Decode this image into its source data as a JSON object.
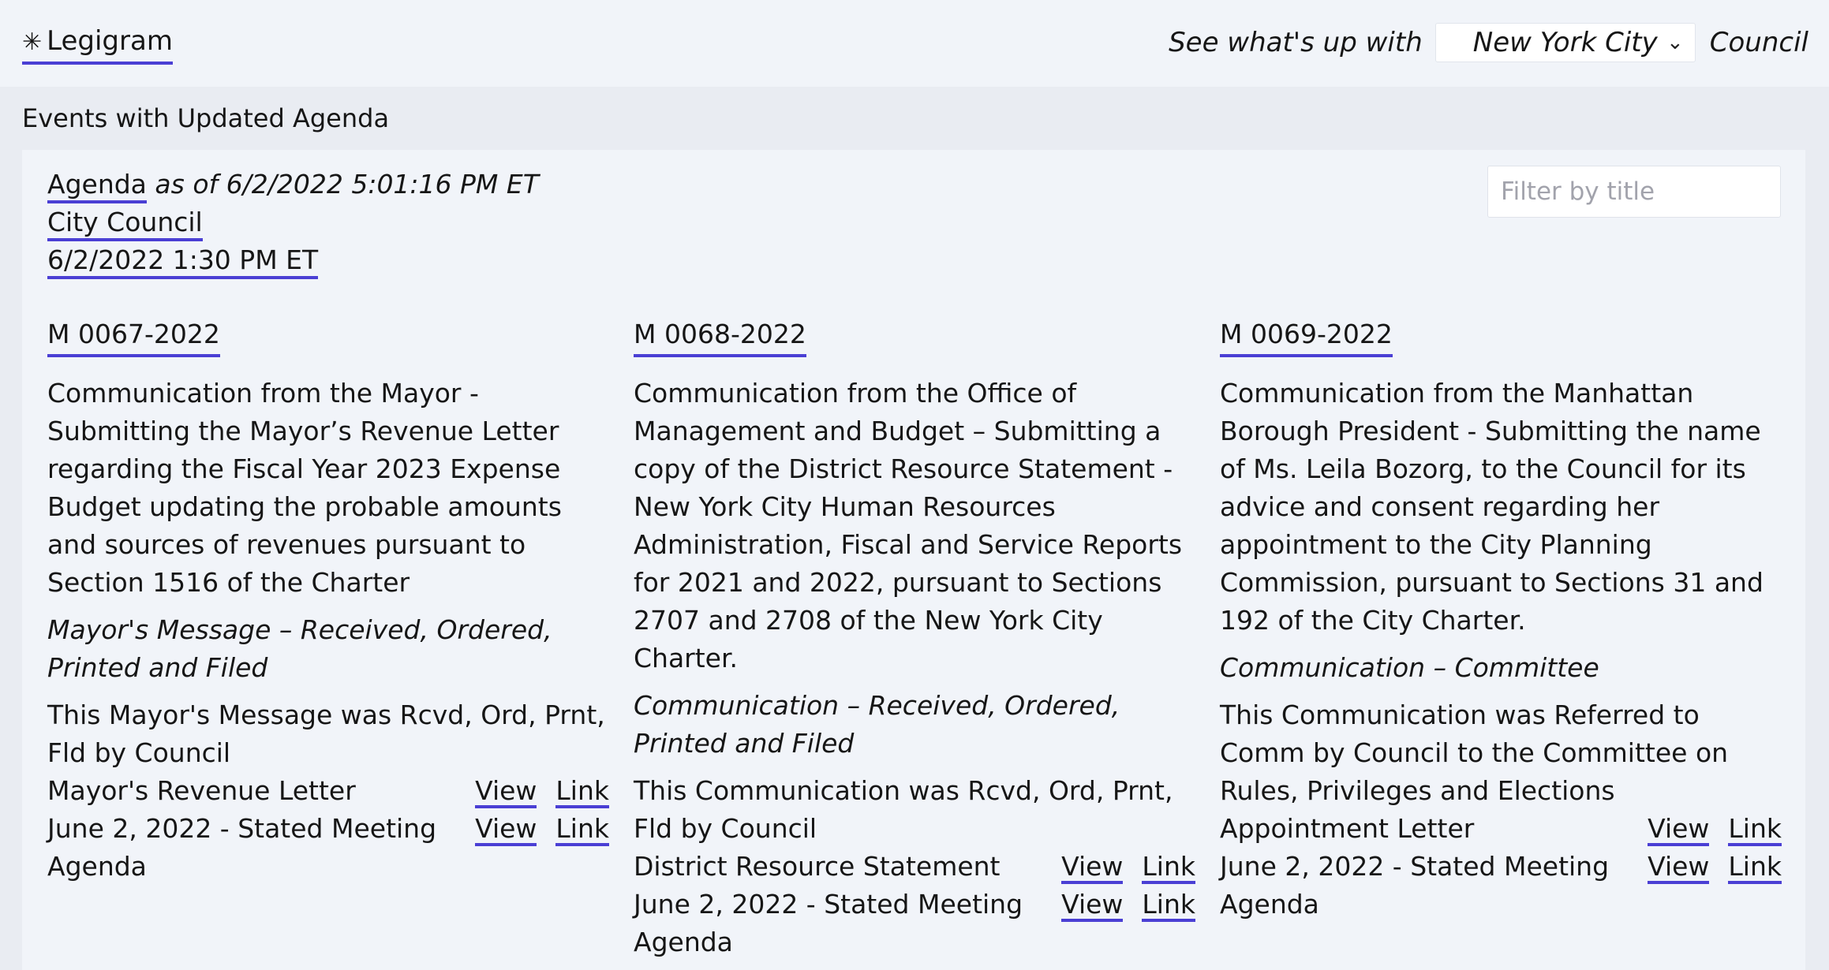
{
  "header": {
    "brand_icon": "asterisk-icon",
    "brand": "Legigram",
    "prompt": "See what's up with",
    "city": "New York City",
    "suffix": "Council"
  },
  "section": {
    "title": "Events with Updated Agenda"
  },
  "event": {
    "agenda_label": "Agenda",
    "as_of": "as of 6/2/2022 5:01:16 PM ET",
    "body": "City Council",
    "datetime": "6/2/2022 1:30 PM ET",
    "filter_placeholder": "Filter by title"
  },
  "items": [
    {
      "number": "M 0067-2022",
      "description": "Communication from the Mayor - Submitting the Mayor’s Revenue Letter regarding the Fiscal Year 2023 Expense Budget updating the probable amounts and sources of revenues pursuant to Section 1516 of the Charter",
      "action": "Mayor's Message – Received, Ordered, Printed and Filed",
      "result": "This Mayor's Message was Rcvd, Ord, Prnt, Fld by Council",
      "attachments": [
        {
          "name": "Mayor's Revenue Letter",
          "view": "View",
          "link": "Link"
        },
        {
          "name": "June 2, 2022 - Stated Meeting Agenda",
          "view": "View",
          "link": "Link"
        }
      ]
    },
    {
      "number": "M 0068-2022",
      "description": "Communication from the Office of Management and Budget – Submitting a copy of the District Resource Statement - New York City Human Resources Administration, Fiscal and Service Reports for 2021 and 2022, pursuant to Sections 2707 and 2708 of the New York City Charter.",
      "action": "Communication – Received, Ordered, Printed and Filed",
      "result": "This Communication was Rcvd, Ord, Prnt, Fld by Council",
      "attachments": [
        {
          "name": "District Resource Statement",
          "view": "View",
          "link": "Link"
        },
        {
          "name": "June 2, 2022 - Stated Meeting Agenda",
          "view": "View",
          "link": "Link"
        }
      ]
    },
    {
      "number": "M 0069-2022",
      "description": "Communication from the Manhattan Borough President - Submitting the name of Ms. Leila Bozorg, to the Council for its advice and consent regarding her appointment to the City Planning Commission, pursuant to Sections 31 and 192 of the City Charter.",
      "action": "Communication – Committee",
      "result": "This Communication was Referred to Comm by Council to the Committee on Rules, Privileges and Elections",
      "attachments": [
        {
          "name": "Appointment Letter",
          "view": "View",
          "link": "Link"
        },
        {
          "name": "June 2, 2022 - Stated Meeting Agenda",
          "view": "View",
          "link": "Link"
        }
      ]
    }
  ]
}
